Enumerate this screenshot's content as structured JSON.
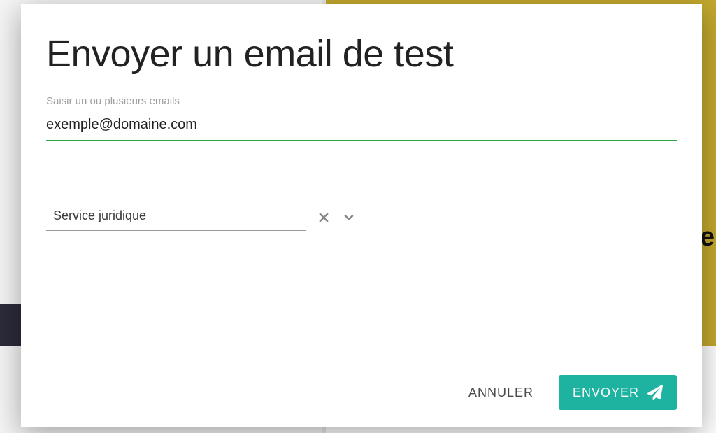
{
  "modal": {
    "title": "Envoyer un email de test",
    "email_field": {
      "label": "Saisir un ou plusieurs emails",
      "value": "exemple@domaine.com"
    },
    "select": {
      "value": "Service juridique"
    },
    "footer": {
      "cancel": "ANNULER",
      "send": "ENVOYER"
    }
  },
  "colors": {
    "accent_green": "#2aa34a",
    "primary_teal": "#1eb2a0"
  }
}
